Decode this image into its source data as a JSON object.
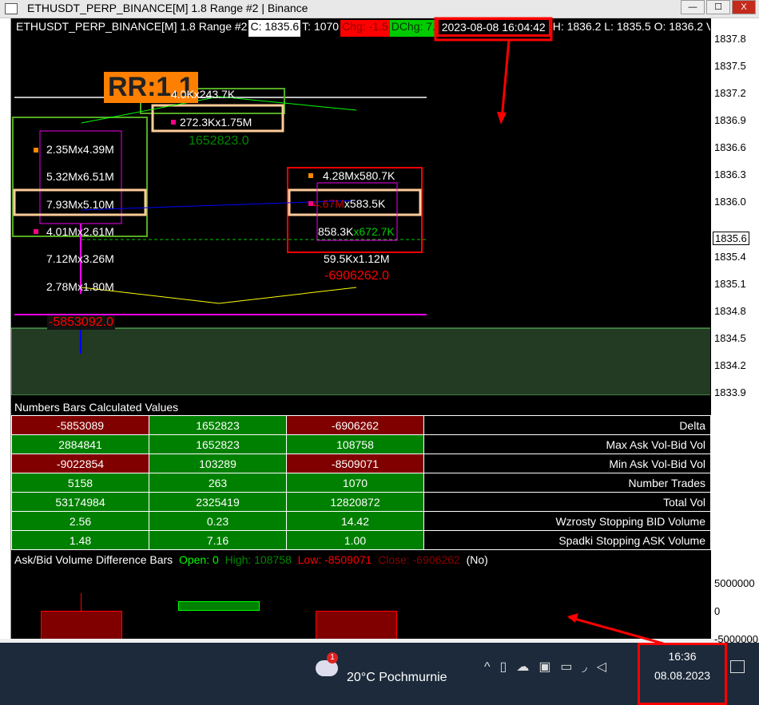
{
  "window": {
    "title": "ETHUSDT_PERP_BINANCE[M]  1.8 Range #2 | Binance",
    "min": "—",
    "max": "☐",
    "close": "X"
  },
  "infobar": {
    "symbol": "ETHUSDT_PERP_BINANCE[M]  1.8 Range #2",
    "close": "C: 1835.6",
    "trades": "T: 1070",
    "chg": "Chg: -1.5",
    "dchg": "DChg: 7.4",
    "datetime": "2023-08-08 16:04:42",
    "hlo": "H: 1836.2 L: 1835.5 O: 1836.2 V"
  },
  "price_axis": [
    "1837.8",
    "1837.5",
    "1837.2",
    "1836.9",
    "1836.6",
    "1836.3",
    "1836.0",
    "1835.4",
    "1835.1",
    "1834.8",
    "1834.5",
    "1834.2",
    "1833.9"
  ],
  "current_price": "1835.6",
  "rr_label": "RR:1.1",
  "footprint": {
    "bar1": [
      "2.35Mx4.39M",
      "5.32Mx6.51M",
      "7.93Mx5.10M",
      "4.01Mx2.61M",
      "7.12Mx3.26M",
      "2.78Mx1.80M"
    ],
    "bar1_delta": "-5853092.0",
    "bar2": [
      "4.0Kx243.7K",
      "272.3Kx1.75M"
    ],
    "bar2_delta": "1652823.0",
    "bar3": [
      "4.28Mx580.7K",
      "4.67M",
      "x583.5K",
      "858.3K",
      "x672.7K",
      "59.5Kx1.12M"
    ],
    "bar3_delta": "-6906262.0"
  },
  "table": {
    "title": "Numbers Bars Calculated Values",
    "rows": [
      {
        "label": "Delta",
        "values": [
          "-5853089",
          "1652823",
          "-6906262"
        ],
        "colors": [
          "red",
          "grn",
          "red"
        ]
      },
      {
        "label": "Max Ask Vol-Bid Vol",
        "values": [
          "2884841",
          "1652823",
          "108758"
        ],
        "colors": [
          "grn",
          "grn",
          "grn"
        ]
      },
      {
        "label": "Min Ask Vol-Bid Vol",
        "values": [
          "-9022854",
          "103289",
          "-8509071"
        ],
        "colors": [
          "red",
          "grn",
          "red"
        ]
      },
      {
        "label": "Number Trades",
        "values": [
          "5158",
          "263",
          "1070"
        ],
        "colors": [
          "grn",
          "grn",
          "grn"
        ]
      },
      {
        "label": "Total Vol",
        "values": [
          "53174984",
          "2325419",
          "12820872"
        ],
        "colors": [
          "grn",
          "grn",
          "grn"
        ]
      },
      {
        "label": "Wzrosty Stopping BID Volume",
        "values": [
          "2.56",
          "0.23",
          "14.42"
        ],
        "colors": [
          "grn",
          "grn",
          "grn"
        ]
      },
      {
        "label": "Spadki Stopping ASK Volume",
        "values": [
          "1.48",
          "7.16",
          "1.00"
        ],
        "colors": [
          "grn",
          "grn",
          "grn"
        ]
      }
    ]
  },
  "diffbars": {
    "title": "Ask/Bid Volume Difference Bars",
    "open": "Open: 0",
    "high": "High: 108758",
    "low": "Low: -8509071",
    "close": "Close: -6906262",
    "no": "(No)",
    "axis": [
      "5000000",
      "0",
      "-5000000"
    ]
  },
  "taskbar": {
    "weather": "20°C  Pochmurnie",
    "badge": "1",
    "time": "16:36",
    "date": "08.08.2023"
  }
}
